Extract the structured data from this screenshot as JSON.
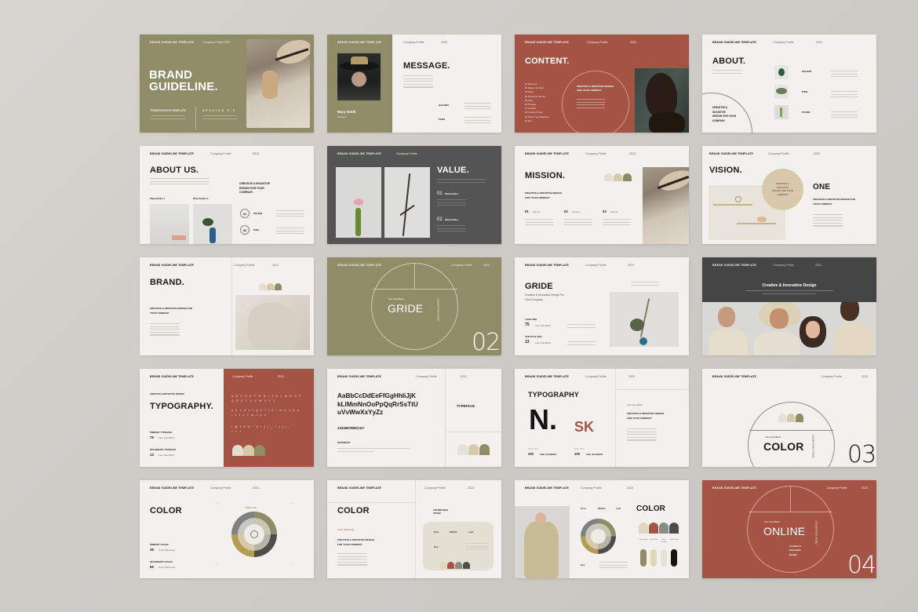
{
  "common": {
    "template_label": "BRAND GUIDELINE TEMPLATE",
    "company_profile": "Company Profile",
    "year": "2023"
  },
  "colors": {
    "olive": "#8f8c67",
    "rust": "#a55345",
    "dark_gray": "#545454",
    "cream": "#f2f1ee",
    "beige": "#d8c9ab",
    "light_beige": "#e3ddd0",
    "sand": "#ccbd9c",
    "gray": "#8a8a87",
    "charcoal": "#4d4d4b",
    "black": "#141414"
  },
  "slides": [
    {
      "id": "brand-guideline",
      "title_line1": "BRAND",
      "title_line2": "GUIDELINE.",
      "label_left": "PRESENTATION TEMPLATE",
      "label_right": "SESSION 0.8",
      "company": "Company Profile 2023"
    },
    {
      "id": "message",
      "title": "MESSAGE.",
      "person_name": "Mary Smith",
      "person_role": "Manager",
      "items": [
        "GOLDEN",
        "PIXEL"
      ]
    },
    {
      "id": "content",
      "title": "CONTENT.",
      "circle_text_l1": "CREATIVE & INOVATIVE DESIGN",
      "circle_text_l2": "FOR YOUR COMPANY",
      "list": [
        "01 About Us",
        "02 Mission & Vision",
        "03 Value",
        "04 Product & Service",
        "05 Team",
        "06 Timeline",
        "07 Portfolio",
        "08 Contact & Map",
        "09 Thank You Slideshow",
        "10 End"
      ]
    },
    {
      "id": "about",
      "title": "ABOUT.",
      "circle_text": [
        "CREATIVE &",
        "INOVATIVE",
        "DESIGN FOR YOUR",
        "COMPANY"
      ],
      "items": [
        "GOLDEN",
        "PIXEL",
        "STUDIO"
      ]
    },
    {
      "id": "about-us",
      "title": "ABOUT US.",
      "placeholders": [
        "Placeholder I",
        "Placeholder 2"
      ],
      "heading": [
        "CREATIVE & INOVATIVE",
        "DESIGN FOR YOUR",
        "COMPANY."
      ],
      "steps": [
        {
          "num": "01",
          "label": "GOLDEN"
        },
        {
          "num": "02",
          "label": "PIXEL"
        }
      ]
    },
    {
      "id": "value",
      "title": "VALUE.",
      "items": [
        {
          "num": "01",
          "label": "Placeholder"
        },
        {
          "num": "02",
          "label": "Placeholder"
        }
      ]
    },
    {
      "id": "mission",
      "title": "MISSION.",
      "heading": [
        "CREATIVE & INOVATIVE DESIGN",
        "FOR YOUR COMPANY."
      ],
      "items": [
        {
          "num": "01",
          "label": "Mission"
        },
        {
          "num": "02",
          "label": "Mission"
        },
        {
          "num": "03",
          "label": "Mission"
        }
      ]
    },
    {
      "id": "vision",
      "title": "VISION.",
      "circle_text": [
        "CREATIVE &",
        "INOVATIVE",
        "DESIGN FOR YOUR",
        "COMPANY"
      ],
      "side_title": "ONE",
      "side_heading": [
        "CREATIVE & INOVATIVE DESIGN FOR",
        "YOUR COMPANY"
      ]
    },
    {
      "id": "brand",
      "title": "BRAND.",
      "heading": [
        "CREATIVE & INOVATIVE DESIGN FOR",
        "YOUR COMPANY"
      ]
    },
    {
      "id": "gride-section",
      "title": "GRIDE",
      "kicker": "Inter SemiBold",
      "side": [
        "GOLDEN PIXEL",
        "STUDIO"
      ],
      "number": "02"
    },
    {
      "id": "gride",
      "title": "GRIDE",
      "subtitle": [
        "Creative & Innovative Design For",
        "Your Company"
      ],
      "specs": [
        {
          "label": "LOGO SIZE",
          "value": "75",
          "font": "Inter SemiBold"
        },
        {
          "label": "SUB TITLE SIZE",
          "value": "13",
          "font": "Inter SemiBold"
        }
      ]
    },
    {
      "id": "team",
      "title": "Creative & Innovative Design"
    },
    {
      "id": "typography",
      "kicker": "CREATIVE & INOVATIVE DESIGN",
      "title": "TYPOGRAPHY.",
      "upper": "A B C D E F G H I J K L M N O P Q R S T U V W X Y Z",
      "lower": "a b c d e f g h i j k l m n o p q r s t u v w x y z",
      "symbols": "! @ # $ % ^ & * ( ) _ + { } | : \" < > ?",
      "specs": [
        {
          "label": "PRIMARY TYPEFACE",
          "value": "75",
          "font": "Inter SemiBold"
        },
        {
          "label": "SECONDARY TYPEFACE",
          "value": "13",
          "font": "Inter SemiBold"
        }
      ]
    },
    {
      "id": "typeface",
      "alphabet": [
        "AaBbCcDdEeFfGgHhIiJjK",
        "kLlMmNnOoPpQqRrSsTtU",
        "uVvWwXxYyZz"
      ],
      "numbers": "1234567890@&?",
      "secondary_label": "SECONDARY",
      "side_title": "TYPEFACE"
    },
    {
      "id": "typography-2",
      "title": "TYPOGRAPHY",
      "glyph_primary": "N.",
      "glyph_secondary": "SK",
      "specs": [
        {
          "label": "Font Size",
          "value": "200",
          "font": "Inter SemiBold"
        },
        {
          "label": "Font Size",
          "value": "100",
          "font": "Inter SemiBold"
        }
      ],
      "kicker": "Inter SemiBold",
      "heading": [
        "CREATIVE & INOVATIVE DESIGN",
        "FOR YOUR COMPANY"
      ]
    },
    {
      "id": "color-section",
      "title": "COLOR",
      "kicker": "Inter SemiBold",
      "side": [
        "GOLDEN PIXEL",
        "STUDIO"
      ],
      "number": "03"
    },
    {
      "id": "color-wheel",
      "title": "COLOR",
      "wheel_label": "Main Color",
      "specs": [
        {
          "label": "PRIMARY COLOR",
          "value": "35",
          "desc": "Color Marketing"
        },
        {
          "label": "SECONDARY COLOR",
          "value": "65",
          "desc": "Color Difference"
        }
      ]
    },
    {
      "id": "color-card",
      "title": "COLOR",
      "kicker": "Color Marketing",
      "heading": [
        "CREATIVE & INOVATIVE DESIGN",
        "FOR YOUR COMPANY"
      ],
      "studio": [
        "GOLDEN PIXEL",
        "STUDIO"
      ],
      "columns": [
        "Plus",
        "Middle",
        "Last"
      ],
      "row_label": "Key"
    },
    {
      "id": "color-palette",
      "title": "COLOR",
      "columns": [
        "First",
        "Middle",
        "Last"
      ],
      "row_label": "Key",
      "labels": [
        "Color Olive",
        "Color Plain",
        "Color Throws",
        "Color Pixel"
      ]
    },
    {
      "id": "online-section",
      "title": "ONLINE",
      "kicker": "Inter SemiBold",
      "side": [
        "GOLDEN PIXEL",
        "STUDIO"
      ],
      "tagline": [
        "Creative &",
        "Innovative",
        "Design"
      ],
      "number": "04"
    }
  ]
}
